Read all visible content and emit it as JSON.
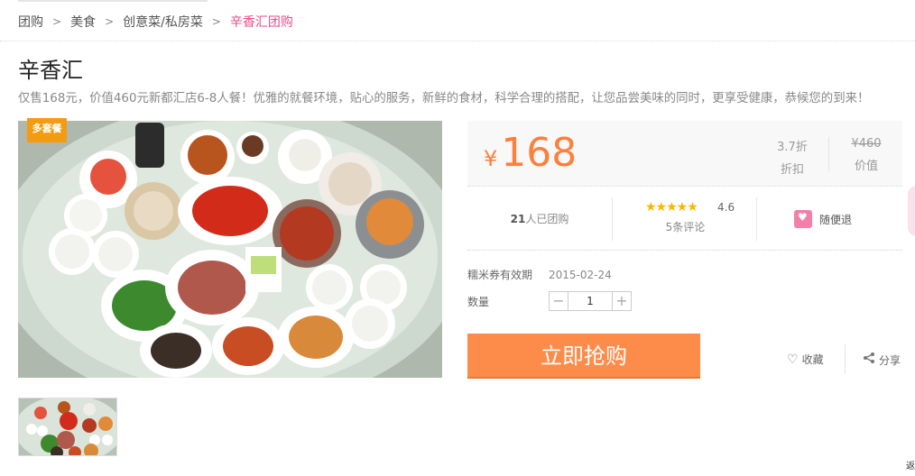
{
  "breadcrumb": [
    "团购",
    "美食",
    "创意菜/私房菜",
    "辛香汇团购"
  ],
  "deal": {
    "title": "辛香汇",
    "description": "仅售168元，价值460元新都汇店6-8人餐！优雅的就餐环境，贴心的服务，新鲜的食材，科学合理的搭配，让您品尝美味的同时，更享受健康，恭候您的到来！",
    "badge": "多套餐"
  },
  "price": {
    "currency": "¥",
    "current": "168",
    "discount_value": "3.7折",
    "discount_label": "折扣",
    "original_value": "¥460",
    "original_label": "价值"
  },
  "stats": {
    "sold_count": "21",
    "sold_suffix": "人已团购",
    "stars": "★★★★★",
    "score": "4.6",
    "reviews": "5条评论",
    "refund": "随便退"
  },
  "voucher": {
    "valid_label": "糯米券有效期",
    "valid_date": "2015-02-24",
    "qty_label": "数量",
    "qty_value": "1",
    "minus": "−",
    "plus": "+"
  },
  "actions": {
    "buy": "立即抢购",
    "favorite": "收藏",
    "share": "分享"
  },
  "edge_text": "返",
  "colors": {
    "accent": "#fd7f3b",
    "button": "#fd8c4a",
    "breadcrumb_current": "#e5508a",
    "star": "#f5b700"
  }
}
